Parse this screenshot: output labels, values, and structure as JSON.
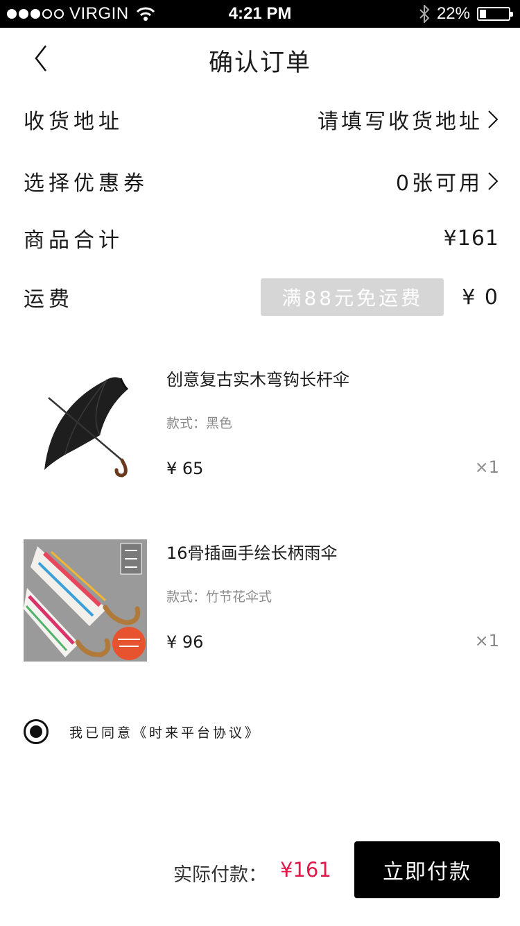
{
  "status_bar": {
    "carrier": "VIRGIN",
    "time": "4:21 PM",
    "battery": "22%",
    "battery_level": 0.22
  },
  "nav": {
    "title": "确认订单"
  },
  "rows": {
    "address": {
      "label": "收货地址",
      "value": "请填写收货地址"
    },
    "coupon": {
      "label": "选择优惠券",
      "value": "0张可用"
    },
    "subtotal": {
      "label": "商品合计",
      "value": "¥161"
    },
    "shipping": {
      "label": "运费",
      "badge": "满88元免运费",
      "value": "¥ 0"
    }
  },
  "products": [
    {
      "name": "创意复古实木弯钩长杆伞",
      "style": "款式：黑色",
      "price": "¥  65",
      "qty": "×1"
    },
    {
      "name": "16骨插画手绘长柄雨伞",
      "style": "款式：竹节花伞式",
      "price": "¥  96",
      "qty": "×1"
    }
  ],
  "agreement": {
    "text": "我已同意《时来平台协议》"
  },
  "footer": {
    "pay_label": "实际付款：",
    "pay_amount": "¥161",
    "pay_button": "立即付款"
  },
  "colors": {
    "accent": "#e0194a",
    "badge_bg": "#d6d6d6",
    "button_bg": "#000000"
  }
}
